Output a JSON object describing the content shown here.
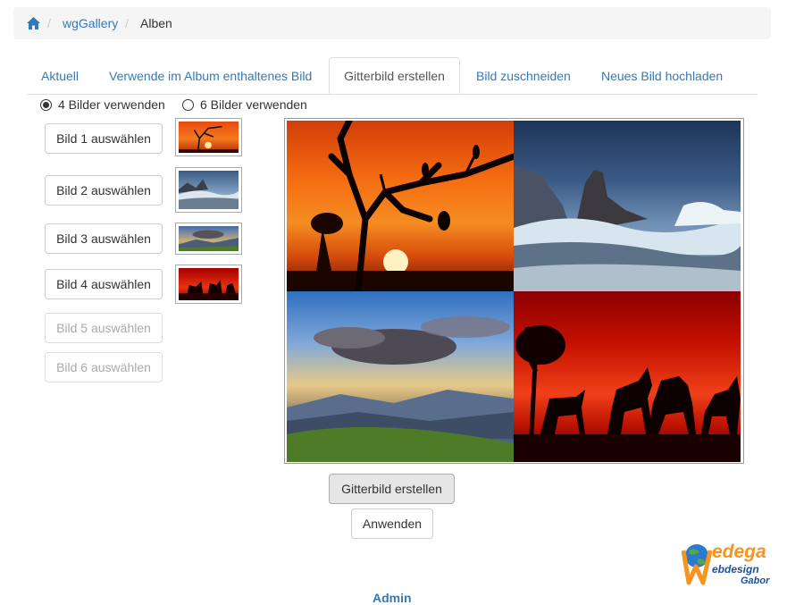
{
  "breadcrumb": {
    "home_icon": "home-icon",
    "items": [
      "wgGallery",
      "Alben"
    ],
    "separator": "/"
  },
  "tabs": [
    {
      "label": "Aktuell",
      "active": false
    },
    {
      "label": "Verwende im Album enthaltenes Bild",
      "active": false
    },
    {
      "label": "Gitterbild erstellen",
      "active": true
    },
    {
      "label": "Bild zuschneiden",
      "active": false
    },
    {
      "label": "Neues Bild hochladen",
      "active": false
    }
  ],
  "radios": {
    "option4": {
      "label": "4 Bilder verwenden",
      "checked": true
    },
    "option6": {
      "label": "6 Bilder verwenden",
      "checked": false
    }
  },
  "select_buttons": [
    {
      "label": "Bild 1 auswählen",
      "enabled": true
    },
    {
      "label": "Bild 2 auswählen",
      "enabled": true
    },
    {
      "label": "Bild 3 auswählen",
      "enabled": true
    },
    {
      "label": "Bild 4 auswählen",
      "enabled": true
    },
    {
      "label": "Bild 5 auswählen",
      "enabled": false
    },
    {
      "label": "Bild 6 auswählen",
      "enabled": false
    }
  ],
  "actions": {
    "create_label": "Gitterbild erstellen",
    "apply_label": "Anwenden"
  },
  "logo": {
    "brand": "wedega",
    "line2": "ebdesign",
    "line3": "Gabor"
  },
  "footer": {
    "admin_label": "Admin"
  },
  "colors": {
    "link": "#337ab7",
    "breadcrumb_bg": "#f5f5f5",
    "logo_orange": "#f7941d",
    "logo_blue": "#1b4f9c"
  }
}
